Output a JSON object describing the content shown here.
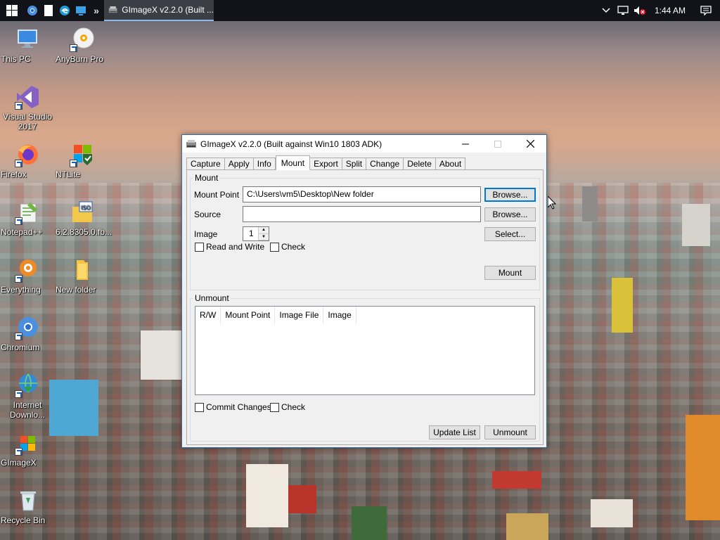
{
  "taskbar": {
    "app_title": "GImageX v2.2.0 (Built ...",
    "overflow_chevron": "»",
    "clock": "1:44 AM"
  },
  "desktop_icons": [
    {
      "label": "This PC"
    },
    {
      "label": "AnyBurn Pro"
    },
    {
      "label": "Visual Studio 2017"
    },
    {
      "label": "Firefox"
    },
    {
      "label": "NTLite"
    },
    {
      "label": "Notepad++"
    },
    {
      "label": "6.2.8305.0.fb..."
    },
    {
      "label": "Everything"
    },
    {
      "label": "New folder"
    },
    {
      "label": "Chromium"
    },
    {
      "label": "Internet Downlo..."
    },
    {
      "label": "GImageX"
    },
    {
      "label": "Recycle Bin"
    }
  ],
  "window": {
    "title": "GImageX v2.2.0 (Built against Win10 1803 ADK)",
    "tabs": [
      "Capture",
      "Apply",
      "Info",
      "Mount",
      "Export",
      "Split",
      "Change",
      "Delete",
      "About"
    ],
    "active_tab": "Mount",
    "mount": {
      "group_label": "Mount",
      "mount_point_label": "Mount Point",
      "mount_point_value": "C:\\Users\\vm5\\Desktop\\New folder",
      "source_label": "Source",
      "source_value": "",
      "image_label": "Image",
      "image_value": "1",
      "browse_label": "Browse...",
      "browse2_label": "Browse...",
      "select_label": "Select...",
      "read_write_label": "Read and Write",
      "check_label": "Check",
      "mount_button": "Mount"
    },
    "unmount": {
      "group_label": "Unmount",
      "columns": [
        "R/W",
        "Mount Point",
        "Image File",
        "Image"
      ],
      "commit_label": "Commit Changes",
      "check_label": "Check",
      "update_list_button": "Update List",
      "unmount_button": "Unmount"
    }
  }
}
